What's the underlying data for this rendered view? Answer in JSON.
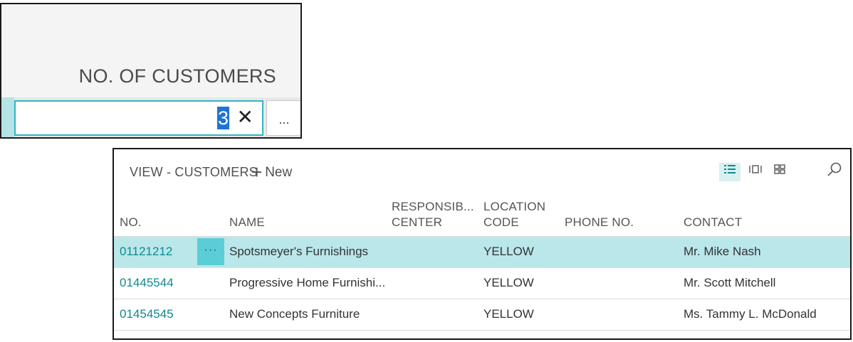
{
  "no_of_customers": {
    "caption": "NO. OF CUSTOMERS",
    "value": "3",
    "clear_glyph": "✕",
    "more_glyph": "..."
  },
  "customer_list": {
    "title": "VIEW - CUSTOMERS",
    "new_label": "New",
    "new_glyph": "+",
    "view_modes": [
      "list-view-icon",
      "tile-view-icon",
      "brick-view-icon"
    ],
    "active_view": "list-view-icon",
    "row_action_glyph": "···",
    "columns": {
      "no": "NO.",
      "name": "NAME",
      "responsibility_center_1": "RESPONSIB...",
      "responsibility_center_2": "CENTER",
      "location_code_1": "LOCATION",
      "location_code_2": "CODE",
      "phone_no": "PHONE NO.",
      "contact": "CONTACT"
    },
    "rows": [
      {
        "no": "01121212",
        "name": "Spotsmeyer's Furnishings",
        "responsibility_center": "",
        "location_code": "YELLOW",
        "phone_no": "",
        "contact": "Mr. Mike Nash",
        "selected": true
      },
      {
        "no": "01445544",
        "name": "Progressive Home Furnishi...",
        "responsibility_center": "",
        "location_code": "YELLOW",
        "phone_no": "",
        "contact": "Mr. Scott Mitchell",
        "selected": false
      },
      {
        "no": "01454545",
        "name": "New Concepts Furniture",
        "responsibility_center": "",
        "location_code": "YELLOW",
        "phone_no": "",
        "contact": "Ms. Tammy L. McDonald",
        "selected": false
      }
    ]
  },
  "colors": {
    "accent": "#0f8990",
    "selected_row": "#b9e7ea",
    "field_border": "#2fb6bf",
    "text_selection": "#1e73d6"
  }
}
